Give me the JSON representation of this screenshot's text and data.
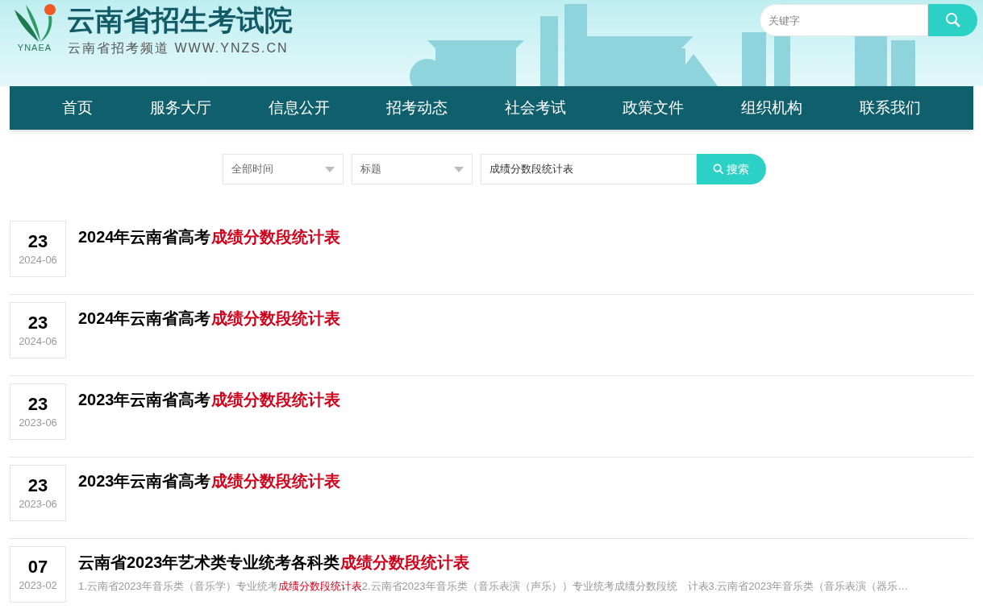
{
  "header": {
    "logo_caption": "YNAEA",
    "site_title": "云南省招生考试院",
    "site_subtitle": "云南省招考频道 WWW.YNZS.CN",
    "search": {
      "placeholder": "关键字"
    }
  },
  "nav": [
    {
      "label": "首页"
    },
    {
      "label": "服务大厅"
    },
    {
      "label": "信息公开"
    },
    {
      "label": "招考动态"
    },
    {
      "label": "社会考试"
    },
    {
      "label": "政策文件"
    },
    {
      "label": "组织机构"
    },
    {
      "label": "联系我们"
    }
  ],
  "filters": {
    "time_select": "全部时间",
    "field_select": "标题",
    "query": "成绩分数段统计表",
    "search_button": "搜索"
  },
  "results": [
    {
      "day": "23",
      "month": "2024-06",
      "title": [
        {
          "text": "2024年云南省高考",
          "highlight": false
        },
        {
          "text": "成绩分数段统计表",
          "highlight": true
        }
      ]
    },
    {
      "day": "23",
      "month": "2024-06",
      "title": [
        {
          "text": "2024年云南省高考",
          "highlight": false
        },
        {
          "text": "成绩分数段统计表",
          "highlight": true
        }
      ]
    },
    {
      "day": "23",
      "month": "2023-06",
      "title": [
        {
          "text": "2023年云南省高考",
          "highlight": false
        },
        {
          "text": "成绩分数段统计表",
          "highlight": true
        }
      ]
    },
    {
      "day": "23",
      "month": "2023-06",
      "title": [
        {
          "text": "2023年云南省高考",
          "highlight": false
        },
        {
          "text": "成绩分数段统计表",
          "highlight": true
        }
      ]
    },
    {
      "day": "07",
      "month": "2023-02",
      "title": [
        {
          "text": "云南省2023年艺术类专业统考各科类",
          "highlight": false
        },
        {
          "text": "成绩分数段统计表",
          "highlight": true
        }
      ],
      "snippet": [
        {
          "text": "1.云南省2023年音乐类（音乐学）专业统考",
          "highlight": false
        },
        {
          "text": "成绩分数段统计表",
          "highlight": true
        },
        {
          "text": "2.云南省2023年音乐类（音乐表演（声乐））专业统考成绩分数段统　计表3.云南省2023年音乐类（音乐表演（器乐…",
          "highlight": false
        }
      ]
    }
  ]
}
